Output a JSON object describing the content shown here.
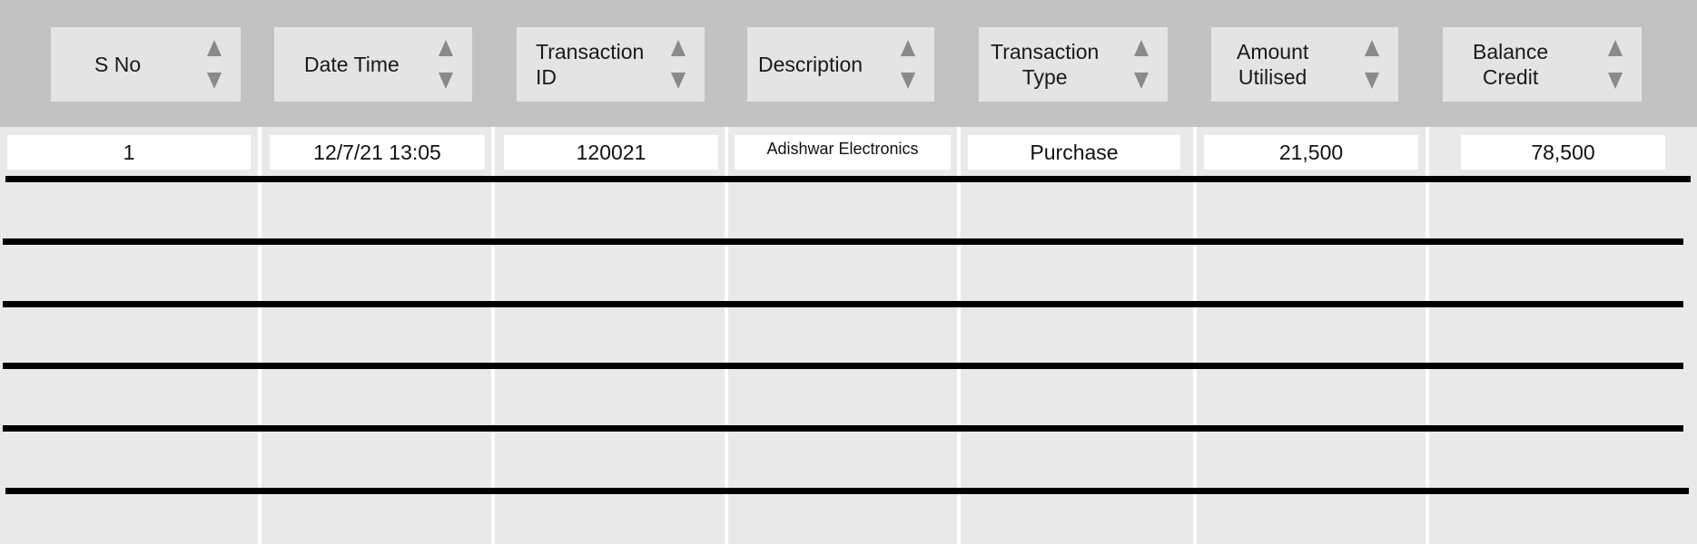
{
  "table": {
    "columns": [
      {
        "label": "S No"
      },
      {
        "label": "Date Time"
      },
      {
        "label": "Transaction\nID"
      },
      {
        "label": "Description"
      },
      {
        "label": "Transaction\nType"
      },
      {
        "label": "Amount\nUtilised"
      },
      {
        "label": "Balance\nCredit"
      }
    ],
    "rows": [
      {
        "s_no": "1",
        "date_time": "12/7/21 13:05",
        "transaction_id": "120021",
        "description": "Adishwar Electronics",
        "transaction_type": "Purchase",
        "amount_utilised": "21,500",
        "balance_credit": "78,500"
      }
    ],
    "sort_icons": {
      "up": "sort-ascending-icon",
      "down": "sort-descending-icon"
    },
    "colors": {
      "header_band": "#c2c2c2",
      "header_cell": "#e4e4e4",
      "body": "#e9e9e9",
      "row_line": "#000000"
    }
  }
}
